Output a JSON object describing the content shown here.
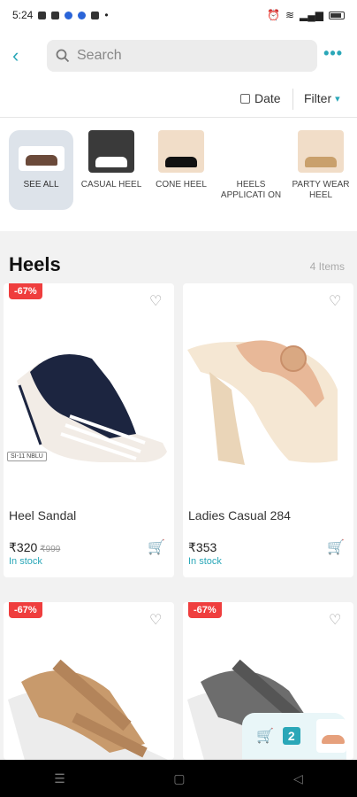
{
  "status_bar": {
    "time": "5:24",
    "notification_icons": [
      "message-icon",
      "snapchat-icon",
      "telegram-icon",
      "app-icon",
      "app-icon"
    ],
    "system_icons": [
      "alarm-icon",
      "wifi-icon",
      "signal-icon",
      "battery-icon"
    ]
  },
  "header": {
    "search_placeholder": "Search",
    "back_icon": "back-icon",
    "more_icon": "more-icon"
  },
  "toolbar": {
    "date_label": "Date",
    "filter_label": "Filter"
  },
  "categories": [
    {
      "label": "SEE ALL"
    },
    {
      "label": "CASUAL HEEL"
    },
    {
      "label": "CONE HEEL"
    },
    {
      "label": "HEELS APPLICATI ON"
    },
    {
      "label": "PARTY WEAR HEEL"
    }
  ],
  "section": {
    "title": "Heels",
    "count": "4 Items"
  },
  "products": [
    {
      "discount": "-67%",
      "name": "Heel Sandal",
      "price": "₹320",
      "mrp": "₹999",
      "stock": "In stock",
      "tag": "SI-11 NBLU"
    },
    {
      "discount": "",
      "name": "Ladies Casual 284",
      "price": "₹353",
      "mrp": "",
      "stock": "In stock",
      "tag": ""
    },
    {
      "discount": "-67%",
      "name": "",
      "price": "",
      "mrp": "",
      "stock": "",
      "tag": ""
    },
    {
      "discount": "-67%",
      "name": "",
      "price": "",
      "mrp": "",
      "stock": "",
      "tag": ""
    }
  ],
  "floating_cart": {
    "count": "2"
  },
  "colors": {
    "accent": "#2aa7b8",
    "discount": "#ef3e3e"
  }
}
